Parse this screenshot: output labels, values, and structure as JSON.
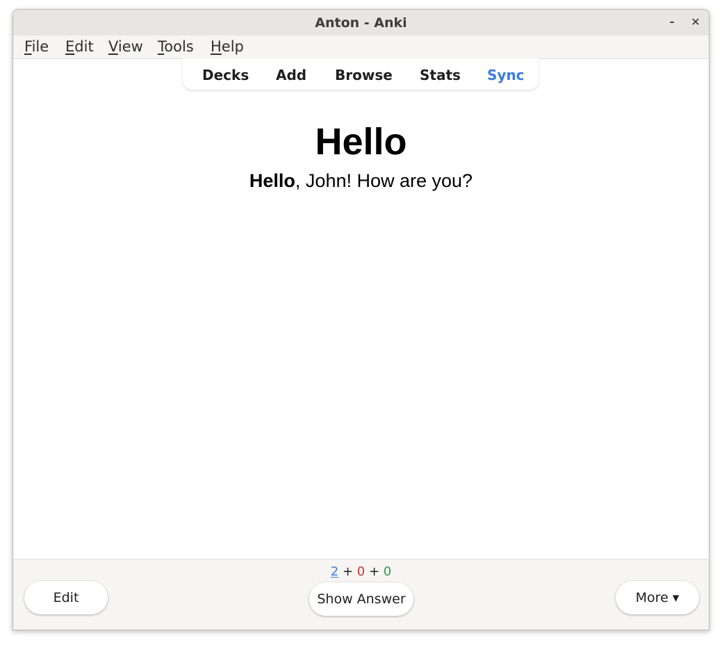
{
  "window": {
    "title": "Anton - Anki",
    "minimize_glyph": "–",
    "close_glyph": "✕"
  },
  "menu": {
    "items": [
      {
        "mnemonic": "F",
        "rest": "ile"
      },
      {
        "mnemonic": "E",
        "rest": "dit"
      },
      {
        "mnemonic": "V",
        "rest": "iew"
      },
      {
        "mnemonic": "T",
        "rest": "ools"
      },
      {
        "mnemonic": "H",
        "rest": "elp"
      }
    ]
  },
  "toolbar": {
    "items": [
      "Decks",
      "Add",
      "Browse",
      "Stats",
      "Sync"
    ],
    "sync_color": "#3b7ddd"
  },
  "card": {
    "heading": "Hello",
    "line_bold": "Hello",
    "line_rest": ", John! How are you?"
  },
  "counts": {
    "new": "2",
    "learn": "0",
    "review": "0",
    "separator": "+",
    "colors": {
      "new": "#3b7ddd",
      "learn": "#d0352b",
      "review": "#2f9e44"
    }
  },
  "bottom": {
    "edit_label": "Edit",
    "show_answer_label": "Show Answer",
    "more_label": "More ▾"
  }
}
